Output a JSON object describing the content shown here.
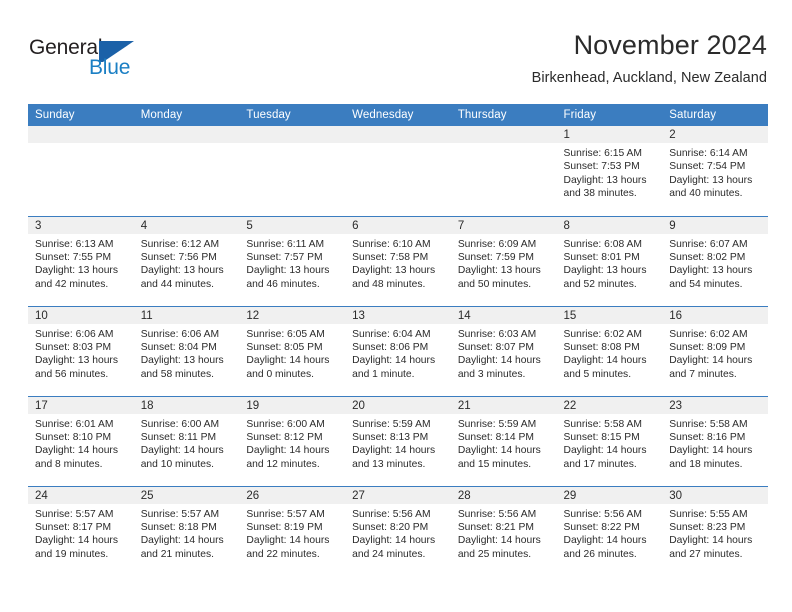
{
  "brand": {
    "name_part1": "General",
    "name_part2": "Blue",
    "mark": "triangle-flag-logo",
    "accent_color": "#1b61a8"
  },
  "header": {
    "title": "November 2024",
    "subtitle": "Birkenhead, Auckland, New Zealand"
  },
  "theme": {
    "header_blue": "#3b7dc0",
    "daynum_band": "#f0f0f0",
    "text": "#2b2b2b"
  },
  "weekday_headers": [
    "Sunday",
    "Monday",
    "Tuesday",
    "Wednesday",
    "Thursday",
    "Friday",
    "Saturday"
  ],
  "weeks": [
    [
      {
        "day": "",
        "sunrise": "",
        "sunset": "",
        "daylight_line1": "",
        "daylight_line2": ""
      },
      {
        "day": "",
        "sunrise": "",
        "sunset": "",
        "daylight_line1": "",
        "daylight_line2": ""
      },
      {
        "day": "",
        "sunrise": "",
        "sunset": "",
        "daylight_line1": "",
        "daylight_line2": ""
      },
      {
        "day": "",
        "sunrise": "",
        "sunset": "",
        "daylight_line1": "",
        "daylight_line2": ""
      },
      {
        "day": "",
        "sunrise": "",
        "sunset": "",
        "daylight_line1": "",
        "daylight_line2": ""
      },
      {
        "day": "1",
        "sunrise": "Sunrise: 6:15 AM",
        "sunset": "Sunset: 7:53 PM",
        "daylight_line1": "Daylight: 13 hours",
        "daylight_line2": "and 38 minutes."
      },
      {
        "day": "2",
        "sunrise": "Sunrise: 6:14 AM",
        "sunset": "Sunset: 7:54 PM",
        "daylight_line1": "Daylight: 13 hours",
        "daylight_line2": "and 40 minutes."
      }
    ],
    [
      {
        "day": "3",
        "sunrise": "Sunrise: 6:13 AM",
        "sunset": "Sunset: 7:55 PM",
        "daylight_line1": "Daylight: 13 hours",
        "daylight_line2": "and 42 minutes."
      },
      {
        "day": "4",
        "sunrise": "Sunrise: 6:12 AM",
        "sunset": "Sunset: 7:56 PM",
        "daylight_line1": "Daylight: 13 hours",
        "daylight_line2": "and 44 minutes."
      },
      {
        "day": "5",
        "sunrise": "Sunrise: 6:11 AM",
        "sunset": "Sunset: 7:57 PM",
        "daylight_line1": "Daylight: 13 hours",
        "daylight_line2": "and 46 minutes."
      },
      {
        "day": "6",
        "sunrise": "Sunrise: 6:10 AM",
        "sunset": "Sunset: 7:58 PM",
        "daylight_line1": "Daylight: 13 hours",
        "daylight_line2": "and 48 minutes."
      },
      {
        "day": "7",
        "sunrise": "Sunrise: 6:09 AM",
        "sunset": "Sunset: 7:59 PM",
        "daylight_line1": "Daylight: 13 hours",
        "daylight_line2": "and 50 minutes."
      },
      {
        "day": "8",
        "sunrise": "Sunrise: 6:08 AM",
        "sunset": "Sunset: 8:01 PM",
        "daylight_line1": "Daylight: 13 hours",
        "daylight_line2": "and 52 minutes."
      },
      {
        "day": "9",
        "sunrise": "Sunrise: 6:07 AM",
        "sunset": "Sunset: 8:02 PM",
        "daylight_line1": "Daylight: 13 hours",
        "daylight_line2": "and 54 minutes."
      }
    ],
    [
      {
        "day": "10",
        "sunrise": "Sunrise: 6:06 AM",
        "sunset": "Sunset: 8:03 PM",
        "daylight_line1": "Daylight: 13 hours",
        "daylight_line2": "and 56 minutes."
      },
      {
        "day": "11",
        "sunrise": "Sunrise: 6:06 AM",
        "sunset": "Sunset: 8:04 PM",
        "daylight_line1": "Daylight: 13 hours",
        "daylight_line2": "and 58 minutes."
      },
      {
        "day": "12",
        "sunrise": "Sunrise: 6:05 AM",
        "sunset": "Sunset: 8:05 PM",
        "daylight_line1": "Daylight: 14 hours",
        "daylight_line2": "and 0 minutes."
      },
      {
        "day": "13",
        "sunrise": "Sunrise: 6:04 AM",
        "sunset": "Sunset: 8:06 PM",
        "daylight_line1": "Daylight: 14 hours",
        "daylight_line2": "and 1 minute."
      },
      {
        "day": "14",
        "sunrise": "Sunrise: 6:03 AM",
        "sunset": "Sunset: 8:07 PM",
        "daylight_line1": "Daylight: 14 hours",
        "daylight_line2": "and 3 minutes."
      },
      {
        "day": "15",
        "sunrise": "Sunrise: 6:02 AM",
        "sunset": "Sunset: 8:08 PM",
        "daylight_line1": "Daylight: 14 hours",
        "daylight_line2": "and 5 minutes."
      },
      {
        "day": "16",
        "sunrise": "Sunrise: 6:02 AM",
        "sunset": "Sunset: 8:09 PM",
        "daylight_line1": "Daylight: 14 hours",
        "daylight_line2": "and 7 minutes."
      }
    ],
    [
      {
        "day": "17",
        "sunrise": "Sunrise: 6:01 AM",
        "sunset": "Sunset: 8:10 PM",
        "daylight_line1": "Daylight: 14 hours",
        "daylight_line2": "and 8 minutes."
      },
      {
        "day": "18",
        "sunrise": "Sunrise: 6:00 AM",
        "sunset": "Sunset: 8:11 PM",
        "daylight_line1": "Daylight: 14 hours",
        "daylight_line2": "and 10 minutes."
      },
      {
        "day": "19",
        "sunrise": "Sunrise: 6:00 AM",
        "sunset": "Sunset: 8:12 PM",
        "daylight_line1": "Daylight: 14 hours",
        "daylight_line2": "and 12 minutes."
      },
      {
        "day": "20",
        "sunrise": "Sunrise: 5:59 AM",
        "sunset": "Sunset: 8:13 PM",
        "daylight_line1": "Daylight: 14 hours",
        "daylight_line2": "and 13 minutes."
      },
      {
        "day": "21",
        "sunrise": "Sunrise: 5:59 AM",
        "sunset": "Sunset: 8:14 PM",
        "daylight_line1": "Daylight: 14 hours",
        "daylight_line2": "and 15 minutes."
      },
      {
        "day": "22",
        "sunrise": "Sunrise: 5:58 AM",
        "sunset": "Sunset: 8:15 PM",
        "daylight_line1": "Daylight: 14 hours",
        "daylight_line2": "and 17 minutes."
      },
      {
        "day": "23",
        "sunrise": "Sunrise: 5:58 AM",
        "sunset": "Sunset: 8:16 PM",
        "daylight_line1": "Daylight: 14 hours",
        "daylight_line2": "and 18 minutes."
      }
    ],
    [
      {
        "day": "24",
        "sunrise": "Sunrise: 5:57 AM",
        "sunset": "Sunset: 8:17 PM",
        "daylight_line1": "Daylight: 14 hours",
        "daylight_line2": "and 19 minutes."
      },
      {
        "day": "25",
        "sunrise": "Sunrise: 5:57 AM",
        "sunset": "Sunset: 8:18 PM",
        "daylight_line1": "Daylight: 14 hours",
        "daylight_line2": "and 21 minutes."
      },
      {
        "day": "26",
        "sunrise": "Sunrise: 5:57 AM",
        "sunset": "Sunset: 8:19 PM",
        "daylight_line1": "Daylight: 14 hours",
        "daylight_line2": "and 22 minutes."
      },
      {
        "day": "27",
        "sunrise": "Sunrise: 5:56 AM",
        "sunset": "Sunset: 8:20 PM",
        "daylight_line1": "Daylight: 14 hours",
        "daylight_line2": "and 24 minutes."
      },
      {
        "day": "28",
        "sunrise": "Sunrise: 5:56 AM",
        "sunset": "Sunset: 8:21 PM",
        "daylight_line1": "Daylight: 14 hours",
        "daylight_line2": "and 25 minutes."
      },
      {
        "day": "29",
        "sunrise": "Sunrise: 5:56 AM",
        "sunset": "Sunset: 8:22 PM",
        "daylight_line1": "Daylight: 14 hours",
        "daylight_line2": "and 26 minutes."
      },
      {
        "day": "30",
        "sunrise": "Sunrise: 5:55 AM",
        "sunset": "Sunset: 8:23 PM",
        "daylight_line1": "Daylight: 14 hours",
        "daylight_line2": "and 27 minutes."
      }
    ]
  ]
}
